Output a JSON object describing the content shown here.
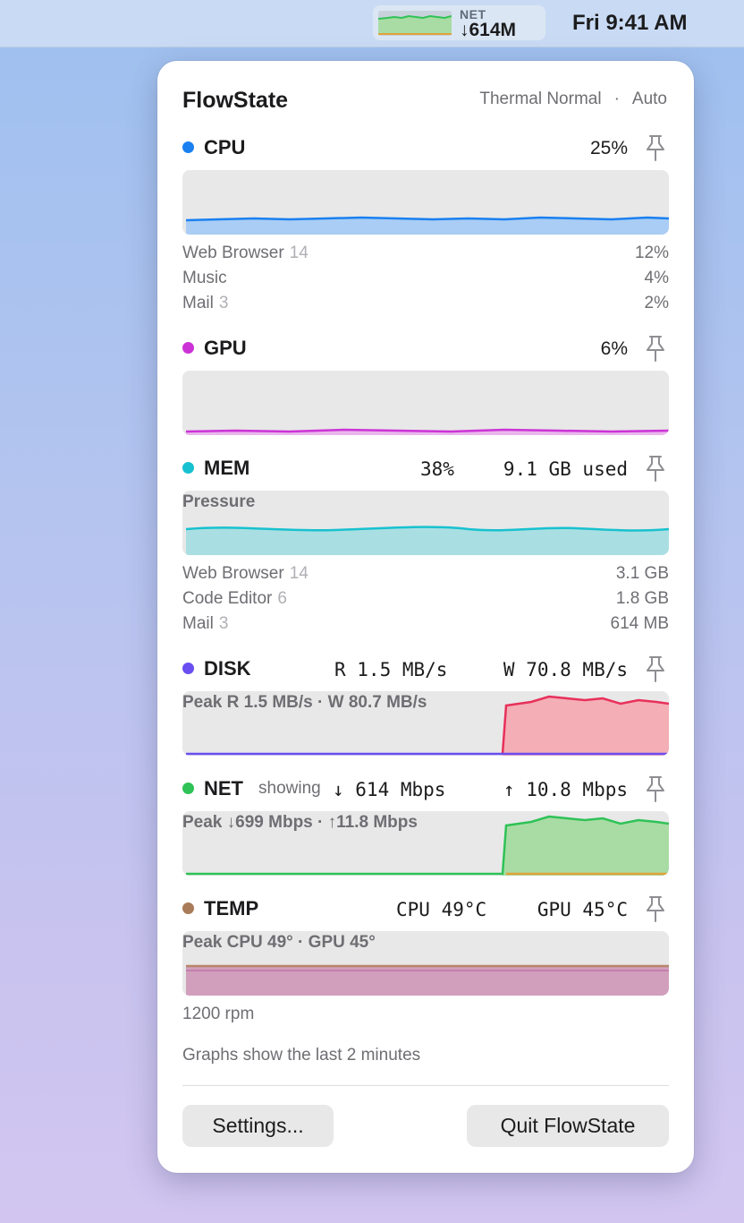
{
  "menubar": {
    "tray": {
      "label": "NET",
      "value": "↓614M"
    },
    "clock": "Fri 9:41 AM"
  },
  "panel": {
    "title": "FlowState",
    "thermal": "Thermal Normal",
    "separator": "·",
    "mode": "Auto",
    "cpu": {
      "name": "CPU",
      "color": "#1a80f0",
      "value": "25%",
      "processes": [
        {
          "name": "Web Browser",
          "count": "14",
          "value": "12%"
        },
        {
          "name": "Music",
          "count": "",
          "value": "4%"
        },
        {
          "name": "Mail",
          "count": "3",
          "value": "2%"
        }
      ]
    },
    "gpu": {
      "name": "GPU",
      "color": "#cc33d6",
      "value": "6%"
    },
    "mem": {
      "name": "MEM",
      "color": "#18c1cf",
      "percent": "38%",
      "used": "9.1 GB used",
      "graph_label": "Pressure",
      "processes": [
        {
          "name": "Web Browser",
          "count": "14",
          "value": "3.1 GB"
        },
        {
          "name": "Code Editor",
          "count": "6",
          "value": "1.8 GB"
        },
        {
          "name": "Mail",
          "count": "3",
          "value": "614 MB"
        }
      ]
    },
    "disk": {
      "name": "DISK",
      "color": "#6a4ef0",
      "read": "R 1.5 MB/s",
      "write": "W 70.8 MB/s",
      "graph_label": "Peak R 1.5 MB/s · W 80.7 MB/s"
    },
    "net": {
      "name": "NET",
      "color": "#2fc257",
      "showing": "showing",
      "down": "↓ 614 Mbps",
      "up": "↑ 10.8 Mbps",
      "graph_label": "Peak ↓699 Mbps · ↑11.8 Mbps"
    },
    "temp": {
      "name": "TEMP",
      "color": "#a97b58",
      "cpu": "CPU 49°C",
      "gpu": "GPU 45°C",
      "graph_label": "Peak CPU 49° · GPU 45°",
      "fan": "1200 rpm"
    },
    "footnote": "Graphs show the last 2 minutes",
    "settings_button": "Settings...",
    "quit_button": "Quit FlowState",
    "icons": {
      "pin": "pin-icon",
      "download": "arrow-down-icon",
      "upload": "arrow-up-icon"
    }
  }
}
